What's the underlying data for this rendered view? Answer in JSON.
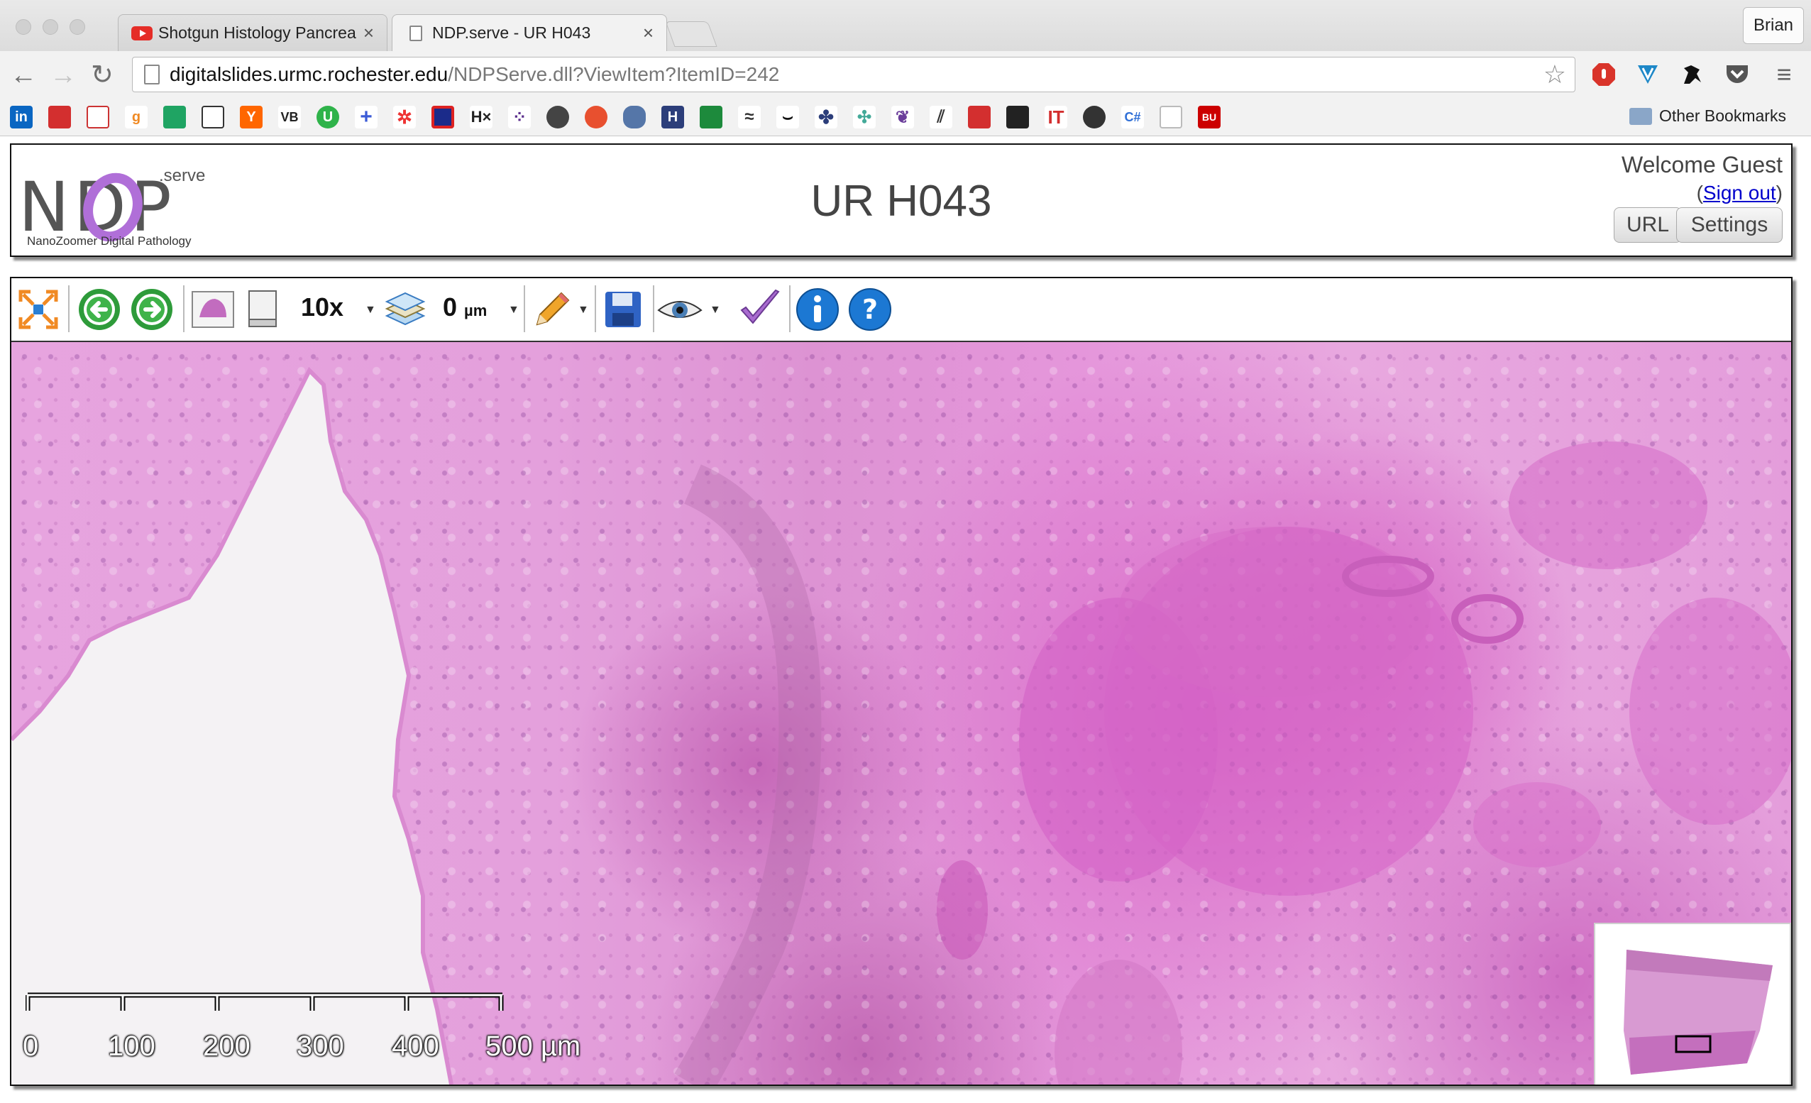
{
  "browser": {
    "tabs": [
      {
        "title": "Shotgun Histology Pancreas",
        "active": false
      },
      {
        "title": "NDP.serve - UR H043",
        "active": true
      }
    ],
    "profile_name": "Brian",
    "url_host": "digitalslides.urmc.rochester.edu",
    "url_path": "/NDPServe.dll?ViewItem?ItemID=242",
    "bookmarks_icons": [
      "linkedin-icon",
      "bookmark-red-icon",
      "bookmark-stack-icon",
      "bookmark-g-icon",
      "mendeley-icon",
      "news-icon",
      "hacker-news-icon",
      "vb-icon",
      "u-icon",
      "plus-icon",
      "flower-icon",
      "grid-icon",
      "hx-icon",
      "dots-icon",
      "appstore-icon",
      "tomato-icon",
      "database-icon",
      "h-icon",
      "wunderlist-icon",
      "stack-icon",
      "mustache-icon",
      "paw-icon",
      "network-icon",
      "feather-icon",
      "lines-icon",
      "chart-icon",
      "dark-app-icon",
      "it-icon",
      "wolfram-icon",
      "csharp-icon",
      "blank-page-icon",
      "bu-icon"
    ],
    "bookmark_labels": {
      "hx": "H×",
      "vb": "VB",
      "u": "U",
      "y": "Y",
      "g": "g",
      "it": "IT",
      "cs": "C#",
      "bu": "BU",
      "in": "in"
    },
    "other_bookmarks": "Other Bookmarks"
  },
  "ndp": {
    "logo": {
      "serve": ".serve",
      "letters": "NDP",
      "tagline": "NanoZoomer Digital Pathology"
    },
    "title": "UR H043",
    "welcome": "Welcome Guest",
    "signout_open": "(",
    "signout": "Sign out",
    "signout_close": ")",
    "url_button": "URL",
    "settings_button": "Settings"
  },
  "viewer": {
    "magnification": "10x",
    "focus_value": "0",
    "focus_unit": "µm",
    "scale_labels": [
      "0",
      "100",
      "200",
      "300",
      "400",
      "500 µm"
    ]
  },
  "colors": {
    "tissue_pink": "#e49ddb",
    "nuclei_purple": "#7a3c8e",
    "lumen_white": "#f4f2f4",
    "overview_box": "#000000",
    "link_blue": "#0000cc"
  }
}
